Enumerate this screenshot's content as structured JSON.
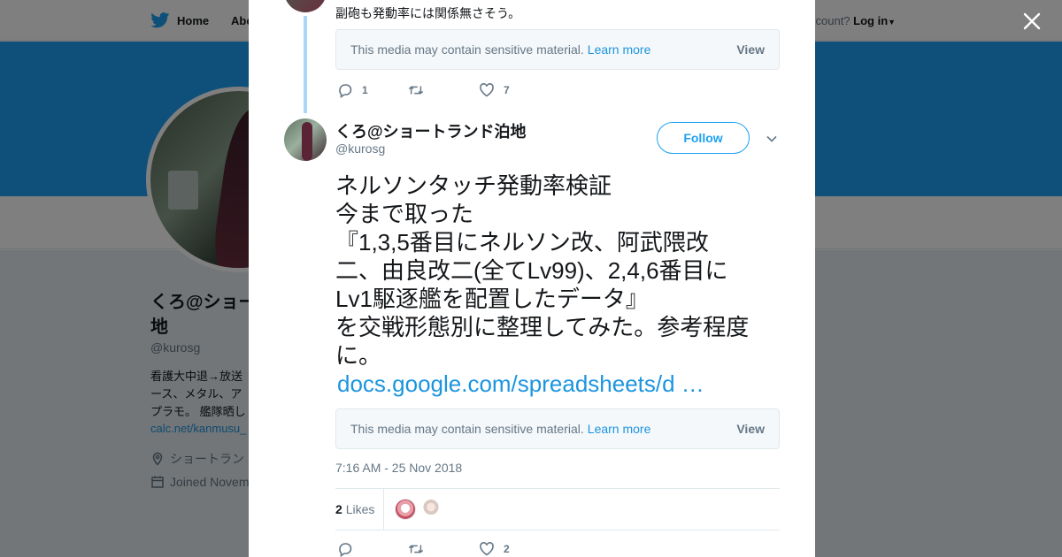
{
  "nav": {
    "home_label": "Home",
    "about_label": "Abo",
    "account_text": "ccount?",
    "login_label": "Log in"
  },
  "profile": {
    "name": "くろ@ショー 地",
    "handle": "@kurosg",
    "bio_line1": "看護大中退→放送",
    "bio_line2": "ース、メタル、ア",
    "bio_line3": "プラモ。 艦隊晒し",
    "link": "calc.net/kanmusu_",
    "location": "ショートラン",
    "joined": "Joined Novem"
  },
  "previous_tweet": {
    "text": "副砲も発動率には関係無さそう。",
    "media_notice": "This media may contain sensitive material.",
    "learn_more": "Learn more",
    "view": "View",
    "reply_count": "1",
    "retweet_count": "",
    "like_count": "7"
  },
  "tweet": {
    "author_name": "くろ@ショートランド泊地",
    "author_handle": "@kurosg",
    "follow_label": "Follow",
    "text": "ネルソンタッチ発動率検証\n今まで取った\n『1,3,5番目にネルソン改、阿武隈改\n二、由良改二(全てLv99)、2,4,6番目に\nLv1駆逐艦を配置したデータ』\nを交戦形態別に整理してみた。参考程度\nに。",
    "link": "docs.google.com/spreadsheets/d …",
    "media_notice": "This media may contain sensitive material.",
    "learn_more": "Learn more",
    "view": "View",
    "timestamp": "7:16 AM - 25 Nov 2018",
    "likes_count": "2",
    "likes_label": "Likes",
    "reply_count": "",
    "retweet_count": "",
    "like_count": "2"
  },
  "colors": {
    "accent": "#1da1f2",
    "link": "#1b95e0",
    "text": "#14171a",
    "muted": "#657786"
  },
  "icons": [
    "twitter-bird-icon",
    "close-icon",
    "reply-icon",
    "retweet-icon",
    "heart-icon",
    "chevron-down-icon",
    "location-icon",
    "calendar-icon"
  ]
}
